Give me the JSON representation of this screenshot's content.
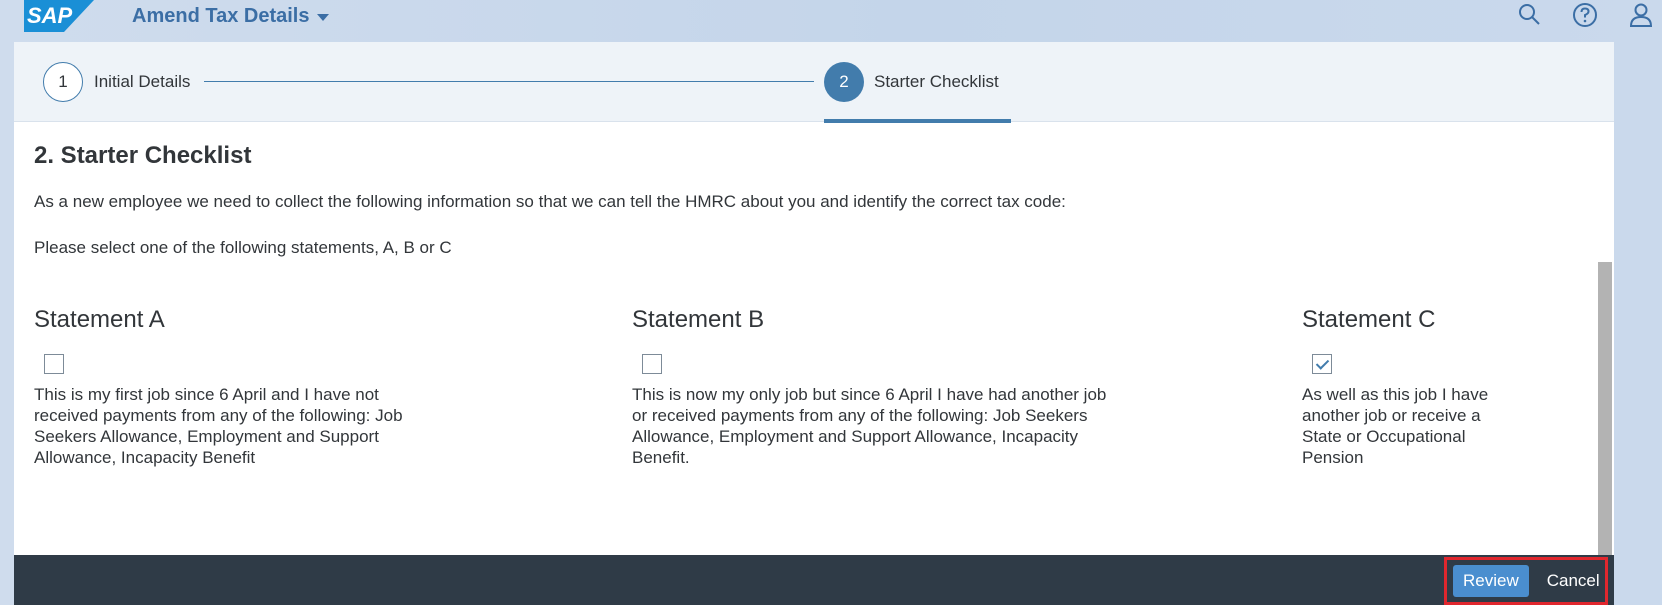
{
  "shell": {
    "logo_text": "SAP",
    "app_title": "Amend Tax Details",
    "icons": [
      "search-icon",
      "help-icon",
      "user-icon"
    ]
  },
  "progress": {
    "steps": [
      {
        "number": "1",
        "label": "Initial Details"
      },
      {
        "number": "2",
        "label": "Starter Checklist"
      }
    ]
  },
  "content": {
    "title": "2. Starter Checklist",
    "intro": "As a new employee we need to collect the following information so that we can tell the HMRC about you and identify the correct tax code:",
    "instruction": "Please select one of the following statements, A, B or C",
    "statements": [
      {
        "heading": "Statement A",
        "checked": false,
        "text": "This is my first job since 6 April and I have not received payments from any of the following: Job Seekers Allowance, Employment and Support Allowance, Incapacity Benefit"
      },
      {
        "heading": "Statement B",
        "checked": false,
        "text": "This is now my only job but since 6 April I have had another job or received payments from any of the following: Job Seekers Allowance, Employment and Support Allowance, Incapacity Benefit."
      },
      {
        "heading": "Statement C",
        "checked": true,
        "text": "As well as this job I have another job or receive a State or Occupational Pension"
      }
    ]
  },
  "footer": {
    "review_label": "Review",
    "cancel_label": "Cancel"
  },
  "colors": {
    "accent": "#427cac",
    "button": "#4a8ecf",
    "footer_bg": "#2f3b47",
    "highlight": "#e0272e"
  }
}
